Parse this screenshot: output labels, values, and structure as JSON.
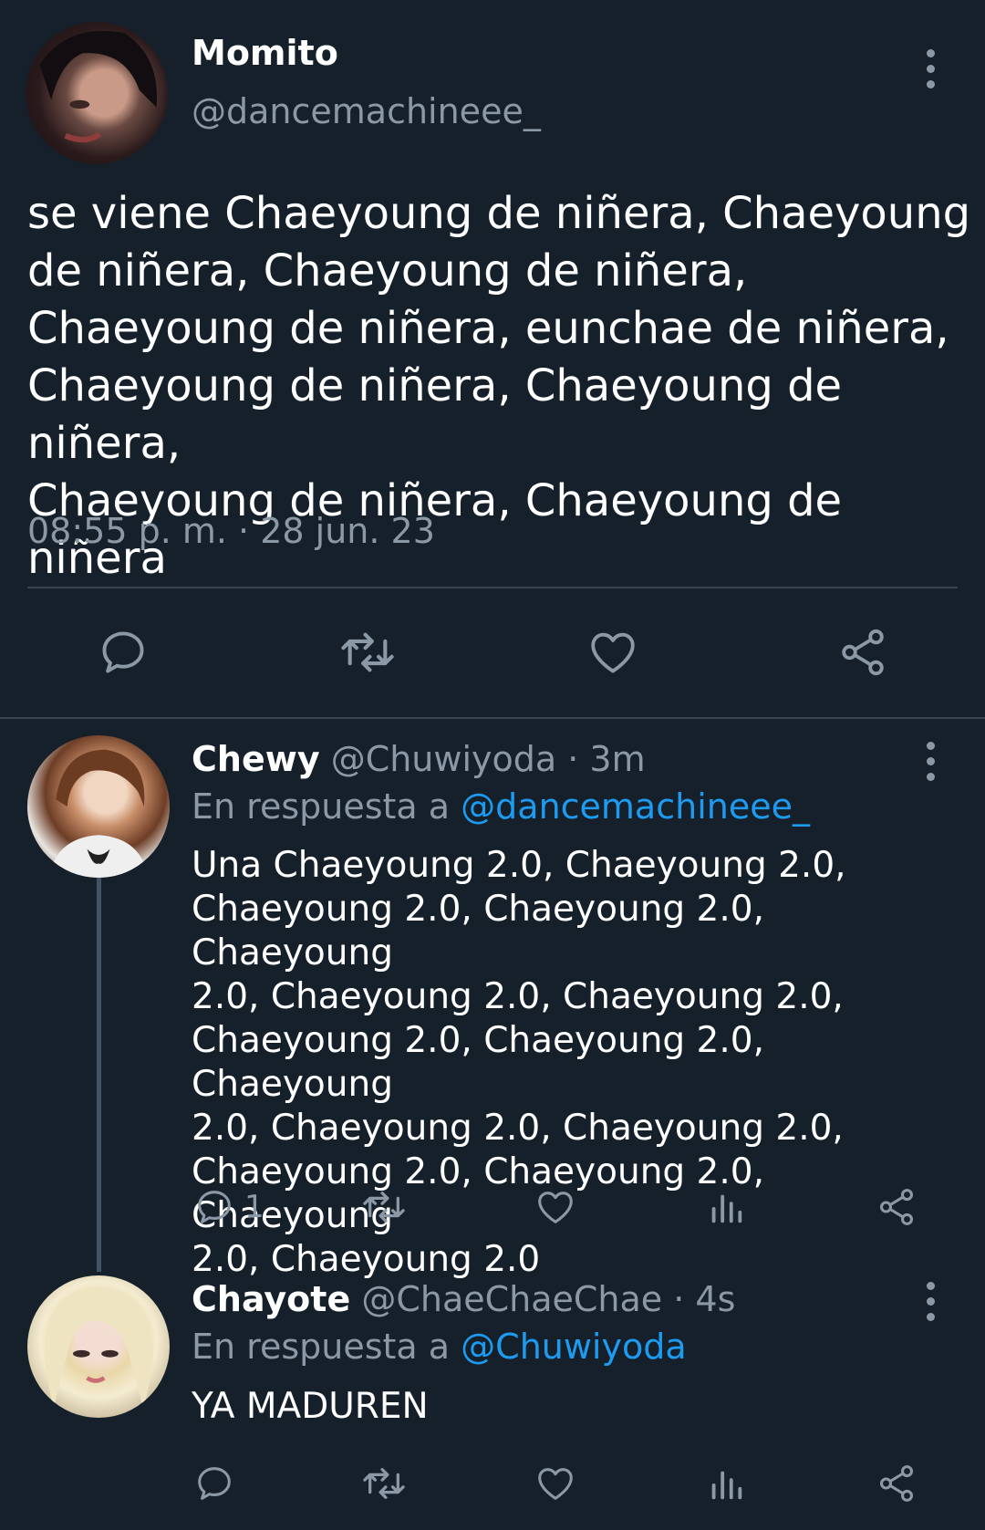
{
  "colors": {
    "background": "#15202b",
    "text": "#ffffff",
    "muted": "#8b98a5",
    "link": "#1d9bf0",
    "divider": "#38444d"
  },
  "main_tweet": {
    "author_name": "Momito",
    "author_handle": "@dancemachineee_",
    "avatar_icon": "user-avatar",
    "more_icon": "more-vertical-icon",
    "text": "se viene Chaeyoung de niñera, Chaeyoung\nde niñera, Chaeyoung  de niñera,\nChaeyoung  de niñera, eunchae de niñera,\nChaeyoung de niñera, Chaeyoung de niñera,\nChaeyoung de niñera, Chaeyoung de niñera",
    "timestamp": "08:55 p. m. · 28 jun. 23",
    "actions": [
      {
        "icon": "reply-icon"
      },
      {
        "icon": "retweet-icon"
      },
      {
        "icon": "like-icon"
      },
      {
        "icon": "share-icon"
      }
    ]
  },
  "replies": [
    {
      "author_name": "Chewy",
      "author_handle": "@Chuwiyoda",
      "time": " · 3m",
      "reply_to_prefix": "En respuesta a ",
      "reply_to_handle": "@dancemachineee_",
      "text": "Una Chaeyoung 2.0, Chaeyoung 2.0,\nChaeyoung 2.0, Chaeyoung  2.0, Chaeyoung\n2.0, Chaeyoung 2.0, Chaeyoung 2.0,\nChaeyoung 2.0, Chaeyoung 2.0, Chaeyoung\n2.0, Chaeyoung 2.0, Chaeyoung 2.0,\nChaeyoung 2.0, Chaeyoung 2.0, Chaeyoung\n2.0, Chaeyoung 2.0",
      "reply_count": "1",
      "actions": [
        {
          "icon": "reply-icon"
        },
        {
          "icon": "retweet-icon"
        },
        {
          "icon": "like-icon"
        },
        {
          "icon": "analytics-icon"
        },
        {
          "icon": "share-icon"
        }
      ]
    },
    {
      "author_name": "Chayote",
      "author_handle": "@ChaeChaeChae",
      "time": " · 4s",
      "reply_to_prefix": "En respuesta a ",
      "reply_to_handle": "@Chuwiyoda",
      "text": "YA MADUREN",
      "actions": [
        {
          "icon": "reply-icon"
        },
        {
          "icon": "retweet-icon"
        },
        {
          "icon": "like-icon"
        },
        {
          "icon": "analytics-icon"
        },
        {
          "icon": "share-icon"
        }
      ]
    }
  ]
}
